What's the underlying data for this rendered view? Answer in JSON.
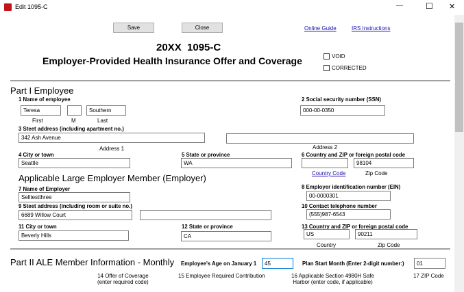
{
  "window": {
    "title": "Edit 1095-C",
    "icon": "app-icon",
    "minimize": "—",
    "maximize": "☐",
    "close": "✕"
  },
  "toolbar": {
    "save": "Save",
    "close": "Close",
    "online_guide": "Online Guide",
    "irs_instructions": "IRS Instructions"
  },
  "form": {
    "year_title": "20XX  1095-C",
    "subtitle": "Employer-Provided Health Insurance Offer and Coverage",
    "void": "VOID",
    "corrected": "CORRECTED"
  },
  "part1": {
    "title": "Part I Employee",
    "name_label": "1 Name of employee",
    "first": "Teresa",
    "middle": "",
    "last": "Southern",
    "first_caption": "First",
    "middle_caption": "M",
    "last_caption": "Last",
    "ssn_label": "2 Social security number (SSN)",
    "ssn": "000-00-0350",
    "street_label": "3 Steet address (including apartment no.)",
    "address1": "342 Ash Avenue",
    "address2": "",
    "address1_caption": "Address 1",
    "address2_caption": "Address 2",
    "city_label": "4 City or town",
    "city": "Seattle",
    "state_label": "5 State or province",
    "state": "WA",
    "zip_label": "6 Country and ZIP or foreign postal code",
    "country": "",
    "zip": "98104",
    "country_caption": "Country Code",
    "zip_caption": "Zip Code"
  },
  "employer": {
    "title": "Applicable Large Employer Member (Employer)",
    "name_label": "7 Name of Employer",
    "name": "Selltestthree",
    "ein_label": "8 Employer identification number (EIN)",
    "ein": "00-0000301",
    "street_label": "9 Steet address (including room or suite no.)",
    "address1": "6689 Willow Court",
    "address2": "",
    "phone_label": "10 Contact telephone number",
    "phone": "(555)987-6543",
    "city_label": "11 City or town",
    "city": "Beverly Hills",
    "state_label": "12 State or province",
    "state": "CA",
    "zip_label": "13 Country and ZIP or foreign postal code",
    "country": "US",
    "zip": "90211",
    "country_caption": "Country",
    "zip_caption": "Zip Code"
  },
  "part2": {
    "title": "Part II ALE Member Information - Monthly",
    "age_label": "Employee's Age on January 1",
    "age": "45",
    "plan_label": "Plan Start Month (Enter 2-digit number:)",
    "plan": "01",
    "col14a": "14 Offer of Coverage",
    "col14b": "(enter required code)",
    "col15": "15 Employee Required Contribution",
    "col16a": "16 Applicable Section 4980H Safe",
    "col16b": "Harbor (enter code, if applicable)",
    "col17": "17 ZIP Code"
  }
}
